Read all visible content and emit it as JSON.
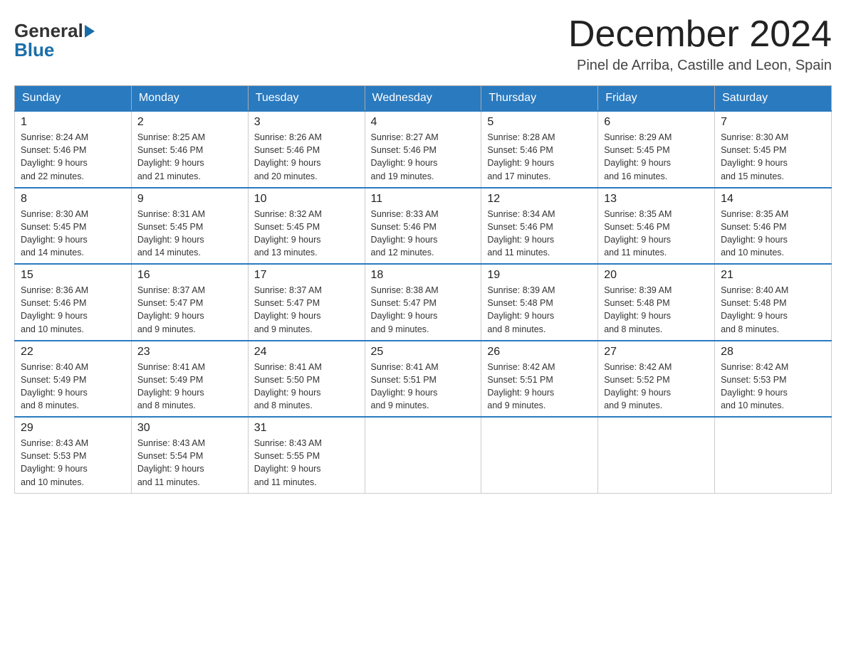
{
  "header": {
    "logo_general": "General",
    "logo_blue": "Blue",
    "month_title": "December 2024",
    "location": "Pinel de Arriba, Castille and Leon, Spain"
  },
  "weekdays": [
    "Sunday",
    "Monday",
    "Tuesday",
    "Wednesday",
    "Thursday",
    "Friday",
    "Saturday"
  ],
  "weeks": [
    [
      {
        "day": "1",
        "sunrise": "8:24 AM",
        "sunset": "5:46 PM",
        "daylight": "9 hours and 22 minutes."
      },
      {
        "day": "2",
        "sunrise": "8:25 AM",
        "sunset": "5:46 PM",
        "daylight": "9 hours and 21 minutes."
      },
      {
        "day": "3",
        "sunrise": "8:26 AM",
        "sunset": "5:46 PM",
        "daylight": "9 hours and 20 minutes."
      },
      {
        "day": "4",
        "sunrise": "8:27 AM",
        "sunset": "5:46 PM",
        "daylight": "9 hours and 19 minutes."
      },
      {
        "day": "5",
        "sunrise": "8:28 AM",
        "sunset": "5:46 PM",
        "daylight": "9 hours and 17 minutes."
      },
      {
        "day": "6",
        "sunrise": "8:29 AM",
        "sunset": "5:45 PM",
        "daylight": "9 hours and 16 minutes."
      },
      {
        "day": "7",
        "sunrise": "8:30 AM",
        "sunset": "5:45 PM",
        "daylight": "9 hours and 15 minutes."
      }
    ],
    [
      {
        "day": "8",
        "sunrise": "8:30 AM",
        "sunset": "5:45 PM",
        "daylight": "9 hours and 14 minutes."
      },
      {
        "day": "9",
        "sunrise": "8:31 AM",
        "sunset": "5:45 PM",
        "daylight": "9 hours and 14 minutes."
      },
      {
        "day": "10",
        "sunrise": "8:32 AM",
        "sunset": "5:45 PM",
        "daylight": "9 hours and 13 minutes."
      },
      {
        "day": "11",
        "sunrise": "8:33 AM",
        "sunset": "5:46 PM",
        "daylight": "9 hours and 12 minutes."
      },
      {
        "day": "12",
        "sunrise": "8:34 AM",
        "sunset": "5:46 PM",
        "daylight": "9 hours and 11 minutes."
      },
      {
        "day": "13",
        "sunrise": "8:35 AM",
        "sunset": "5:46 PM",
        "daylight": "9 hours and 11 minutes."
      },
      {
        "day": "14",
        "sunrise": "8:35 AM",
        "sunset": "5:46 PM",
        "daylight": "9 hours and 10 minutes."
      }
    ],
    [
      {
        "day": "15",
        "sunrise": "8:36 AM",
        "sunset": "5:46 PM",
        "daylight": "9 hours and 10 minutes."
      },
      {
        "day": "16",
        "sunrise": "8:37 AM",
        "sunset": "5:47 PM",
        "daylight": "9 hours and 9 minutes."
      },
      {
        "day": "17",
        "sunrise": "8:37 AM",
        "sunset": "5:47 PM",
        "daylight": "9 hours and 9 minutes."
      },
      {
        "day": "18",
        "sunrise": "8:38 AM",
        "sunset": "5:47 PM",
        "daylight": "9 hours and 9 minutes."
      },
      {
        "day": "19",
        "sunrise": "8:39 AM",
        "sunset": "5:48 PM",
        "daylight": "9 hours and 8 minutes."
      },
      {
        "day": "20",
        "sunrise": "8:39 AM",
        "sunset": "5:48 PM",
        "daylight": "9 hours and 8 minutes."
      },
      {
        "day": "21",
        "sunrise": "8:40 AM",
        "sunset": "5:48 PM",
        "daylight": "9 hours and 8 minutes."
      }
    ],
    [
      {
        "day": "22",
        "sunrise": "8:40 AM",
        "sunset": "5:49 PM",
        "daylight": "9 hours and 8 minutes."
      },
      {
        "day": "23",
        "sunrise": "8:41 AM",
        "sunset": "5:49 PM",
        "daylight": "9 hours and 8 minutes."
      },
      {
        "day": "24",
        "sunrise": "8:41 AM",
        "sunset": "5:50 PM",
        "daylight": "9 hours and 8 minutes."
      },
      {
        "day": "25",
        "sunrise": "8:41 AM",
        "sunset": "5:51 PM",
        "daylight": "9 hours and 9 minutes."
      },
      {
        "day": "26",
        "sunrise": "8:42 AM",
        "sunset": "5:51 PM",
        "daylight": "9 hours and 9 minutes."
      },
      {
        "day": "27",
        "sunrise": "8:42 AM",
        "sunset": "5:52 PM",
        "daylight": "9 hours and 9 minutes."
      },
      {
        "day": "28",
        "sunrise": "8:42 AM",
        "sunset": "5:53 PM",
        "daylight": "9 hours and 10 minutes."
      }
    ],
    [
      {
        "day": "29",
        "sunrise": "8:43 AM",
        "sunset": "5:53 PM",
        "daylight": "9 hours and 10 minutes."
      },
      {
        "day": "30",
        "sunrise": "8:43 AM",
        "sunset": "5:54 PM",
        "daylight": "9 hours and 11 minutes."
      },
      {
        "day": "31",
        "sunrise": "8:43 AM",
        "sunset": "5:55 PM",
        "daylight": "9 hours and 11 minutes."
      },
      null,
      null,
      null,
      null
    ]
  ],
  "labels": {
    "sunrise": "Sunrise:",
    "sunset": "Sunset:",
    "daylight": "Daylight:"
  }
}
